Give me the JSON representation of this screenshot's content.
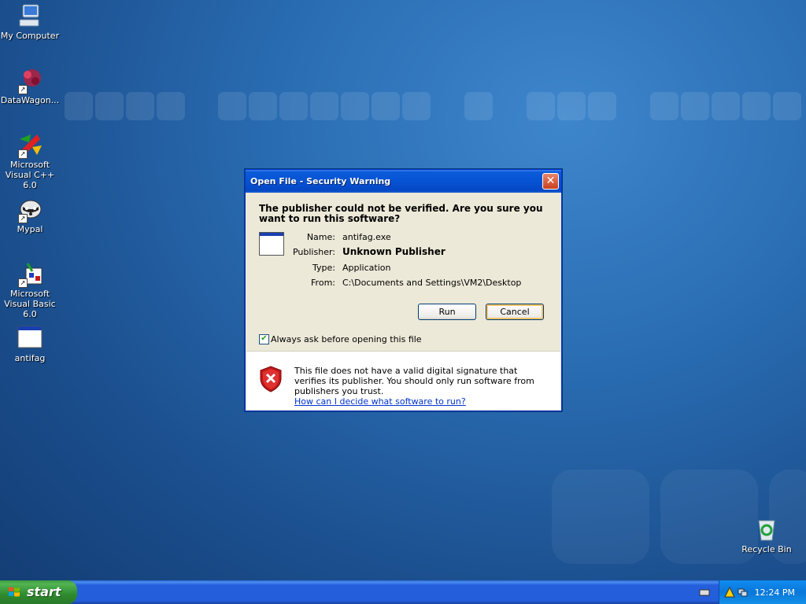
{
  "desktop": {
    "icons": [
      {
        "label": "My Computer"
      },
      {
        "label": "DataWagon..."
      },
      {
        "label": "Microsoft Visual C++ 6.0"
      },
      {
        "label": "Mypal"
      },
      {
        "label": "Microsoft Visual Basic 6.0"
      },
      {
        "label": "antifag"
      },
      {
        "label": "Recycle Bin"
      }
    ]
  },
  "dialog": {
    "title": "Open File - Security Warning",
    "question": "The publisher could not be verified.  Are you sure you want to run this software?",
    "fields": {
      "name_label": "Name:",
      "name_value": "antifag.exe",
      "publisher_label": "Publisher:",
      "publisher_value": "Unknown Publisher",
      "type_label": "Type:",
      "type_value": "Application",
      "from_label": "From:",
      "from_value": "C:\\Documents and Settings\\VM2\\Desktop"
    },
    "run_label": "Run",
    "cancel_label": "Cancel",
    "checkbox_label": "Always ask before opening this file",
    "checkbox_checked": true,
    "warning_text": "This file does not have a valid digital signature that verifies its publisher.  You should only run software from publishers you trust.",
    "help_link": "How can I decide what software to run?"
  },
  "taskbar": {
    "start_label": "start",
    "clock": "12:24 PM"
  },
  "colors": {
    "desktop_bg": "#2a6db3",
    "titlebar": "#0653d4",
    "dialog_bg": "#ece9d8",
    "start_green": "#3c9b3c",
    "link": "#0033cc"
  }
}
